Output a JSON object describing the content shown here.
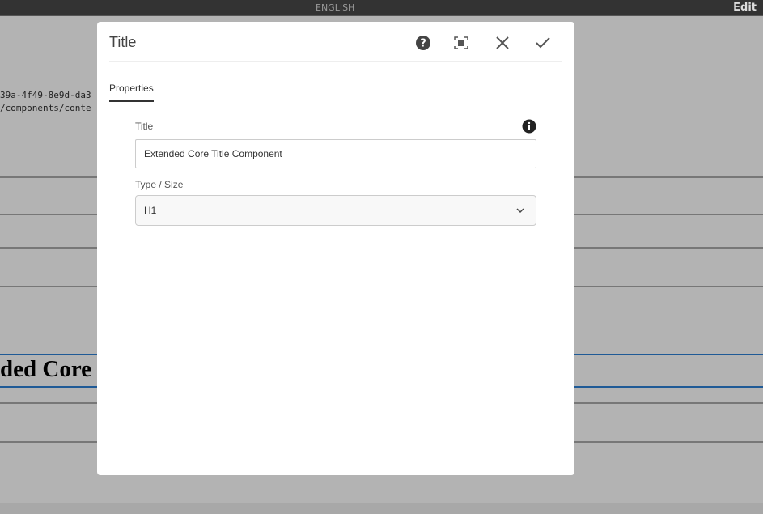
{
  "topbar": {
    "language": "ENGLISH",
    "mode": "Edit"
  },
  "background": {
    "id_line": "39a-4f49-8e9d-da3",
    "path_line": "/components/conte",
    "heading_fragment": "ded Core"
  },
  "dialog": {
    "title": "Title",
    "icons": [
      "help-icon",
      "fullscreen-icon",
      "close-icon",
      "check-icon"
    ],
    "tabs": [
      {
        "label": "Properties",
        "active": true
      }
    ],
    "fields": {
      "title": {
        "label": "Title",
        "value": "Extended Core Title Component"
      },
      "type_size": {
        "label": "Type / Size",
        "value": "H1"
      }
    }
  },
  "colors": {
    "overlay": "#b3b3b3",
    "topbar": "#333333",
    "accent_line": "#1f5a96"
  }
}
